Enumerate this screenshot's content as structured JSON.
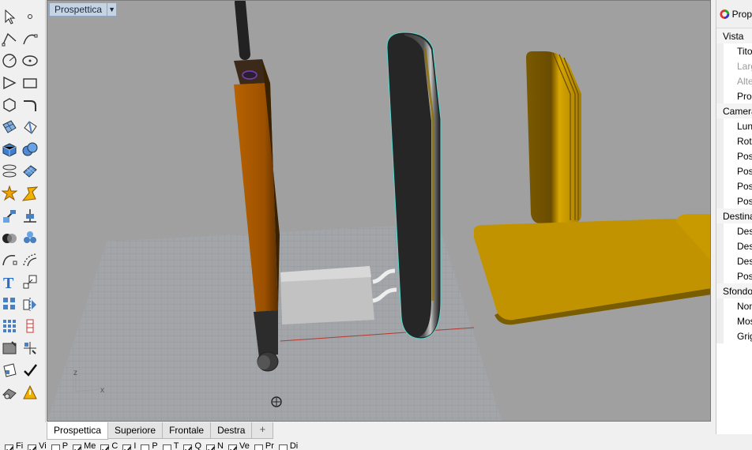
{
  "viewport": {
    "name": "Prospettica",
    "axis_labels": {
      "z": "z",
      "x": "x"
    }
  },
  "tabs": [
    {
      "label": "Prospettica",
      "active": true
    },
    {
      "label": "Superiore",
      "active": false
    },
    {
      "label": "Frontale",
      "active": false
    },
    {
      "label": "Destra",
      "active": false
    }
  ],
  "tab_add_glyph": "+",
  "properties": {
    "title": "Prop",
    "rows": [
      {
        "kind": "section",
        "text": "Vista"
      },
      {
        "kind": "item",
        "text": "Titolo",
        "disabled": false
      },
      {
        "kind": "item",
        "text": "Larghe",
        "disabled": true
      },
      {
        "kind": "item",
        "text": "Altezz",
        "disabled": true
      },
      {
        "kind": "item",
        "text": "Proiez",
        "disabled": false
      },
      {
        "kind": "section",
        "text": "Camera"
      },
      {
        "kind": "item",
        "text": "Lungh",
        "disabled": false
      },
      {
        "kind": "item",
        "text": "Rotaz",
        "disabled": false
      },
      {
        "kind": "item",
        "text": "Posizi",
        "disabled": false
      },
      {
        "kind": "item",
        "text": "Posizi",
        "disabled": false
      },
      {
        "kind": "item",
        "text": "Posizi",
        "disabled": false
      },
      {
        "kind": "item",
        "text": "Posizi",
        "disabled": false
      },
      {
        "kind": "section",
        "text": "Destinaz"
      },
      {
        "kind": "item",
        "text": "Destin",
        "disabled": false
      },
      {
        "kind": "item",
        "text": "Destin",
        "disabled": false
      },
      {
        "kind": "item",
        "text": "Destin",
        "disabled": false
      },
      {
        "kind": "item",
        "text": "Posizi",
        "disabled": false
      },
      {
        "kind": "section",
        "text": "Sfondo"
      },
      {
        "kind": "item",
        "text": "Nome",
        "disabled": false
      },
      {
        "kind": "item",
        "text": "Mostra",
        "disabled": false
      },
      {
        "kind": "item",
        "text": "Grigio",
        "disabled": false
      }
    ]
  },
  "osnaps": [
    {
      "label": "Fi",
      "checked": true
    },
    {
      "label": "Vi",
      "checked": true
    },
    {
      "label": "P",
      "checked": false
    },
    {
      "label": "Me",
      "checked": true
    },
    {
      "label": "C",
      "checked": true
    },
    {
      "label": "I",
      "checked": true
    },
    {
      "label": "P",
      "checked": false
    },
    {
      "label": "T",
      "checked": false
    },
    {
      "label": "Q",
      "checked": true
    },
    {
      "label": "N",
      "checked": true
    },
    {
      "label": "Ve",
      "checked": true
    },
    {
      "label": "Pr",
      "checked": false
    },
    {
      "label": "Di",
      "checked": false
    }
  ],
  "toolbar_tools": [
    "select-arrow-icon",
    "point-icon",
    "polyline-icon",
    "curve-icon",
    "circle-icon",
    "ellipse-icon",
    "polygon-icon",
    "rectangle-icon",
    "arc-icon",
    "fillet-curve-icon",
    "surface-icon",
    "surface-edit-icon",
    "box-icon",
    "sphere-icon",
    "cylinder-icon",
    "mesh-icon",
    "explode-icon",
    "split-icon",
    "gumball-icon",
    "align-icon",
    "boolean-icon",
    "group-icon",
    "curve-edit-icon",
    "offset-icon",
    "text-icon",
    "scale-icon",
    "array-icon",
    "mirror-icon",
    "block-icon",
    "dimension-icon",
    "grid-icon",
    "layout-icon",
    "render-icon",
    "check-icon",
    "material-icon",
    "light-icon"
  ],
  "colors": {
    "viewport_bg": "#a0a0a0",
    "grid": "#9aa3ad",
    "orange_post": "#a35400",
    "gold": "#c99800",
    "dark_device": "#2e2e2e"
  }
}
